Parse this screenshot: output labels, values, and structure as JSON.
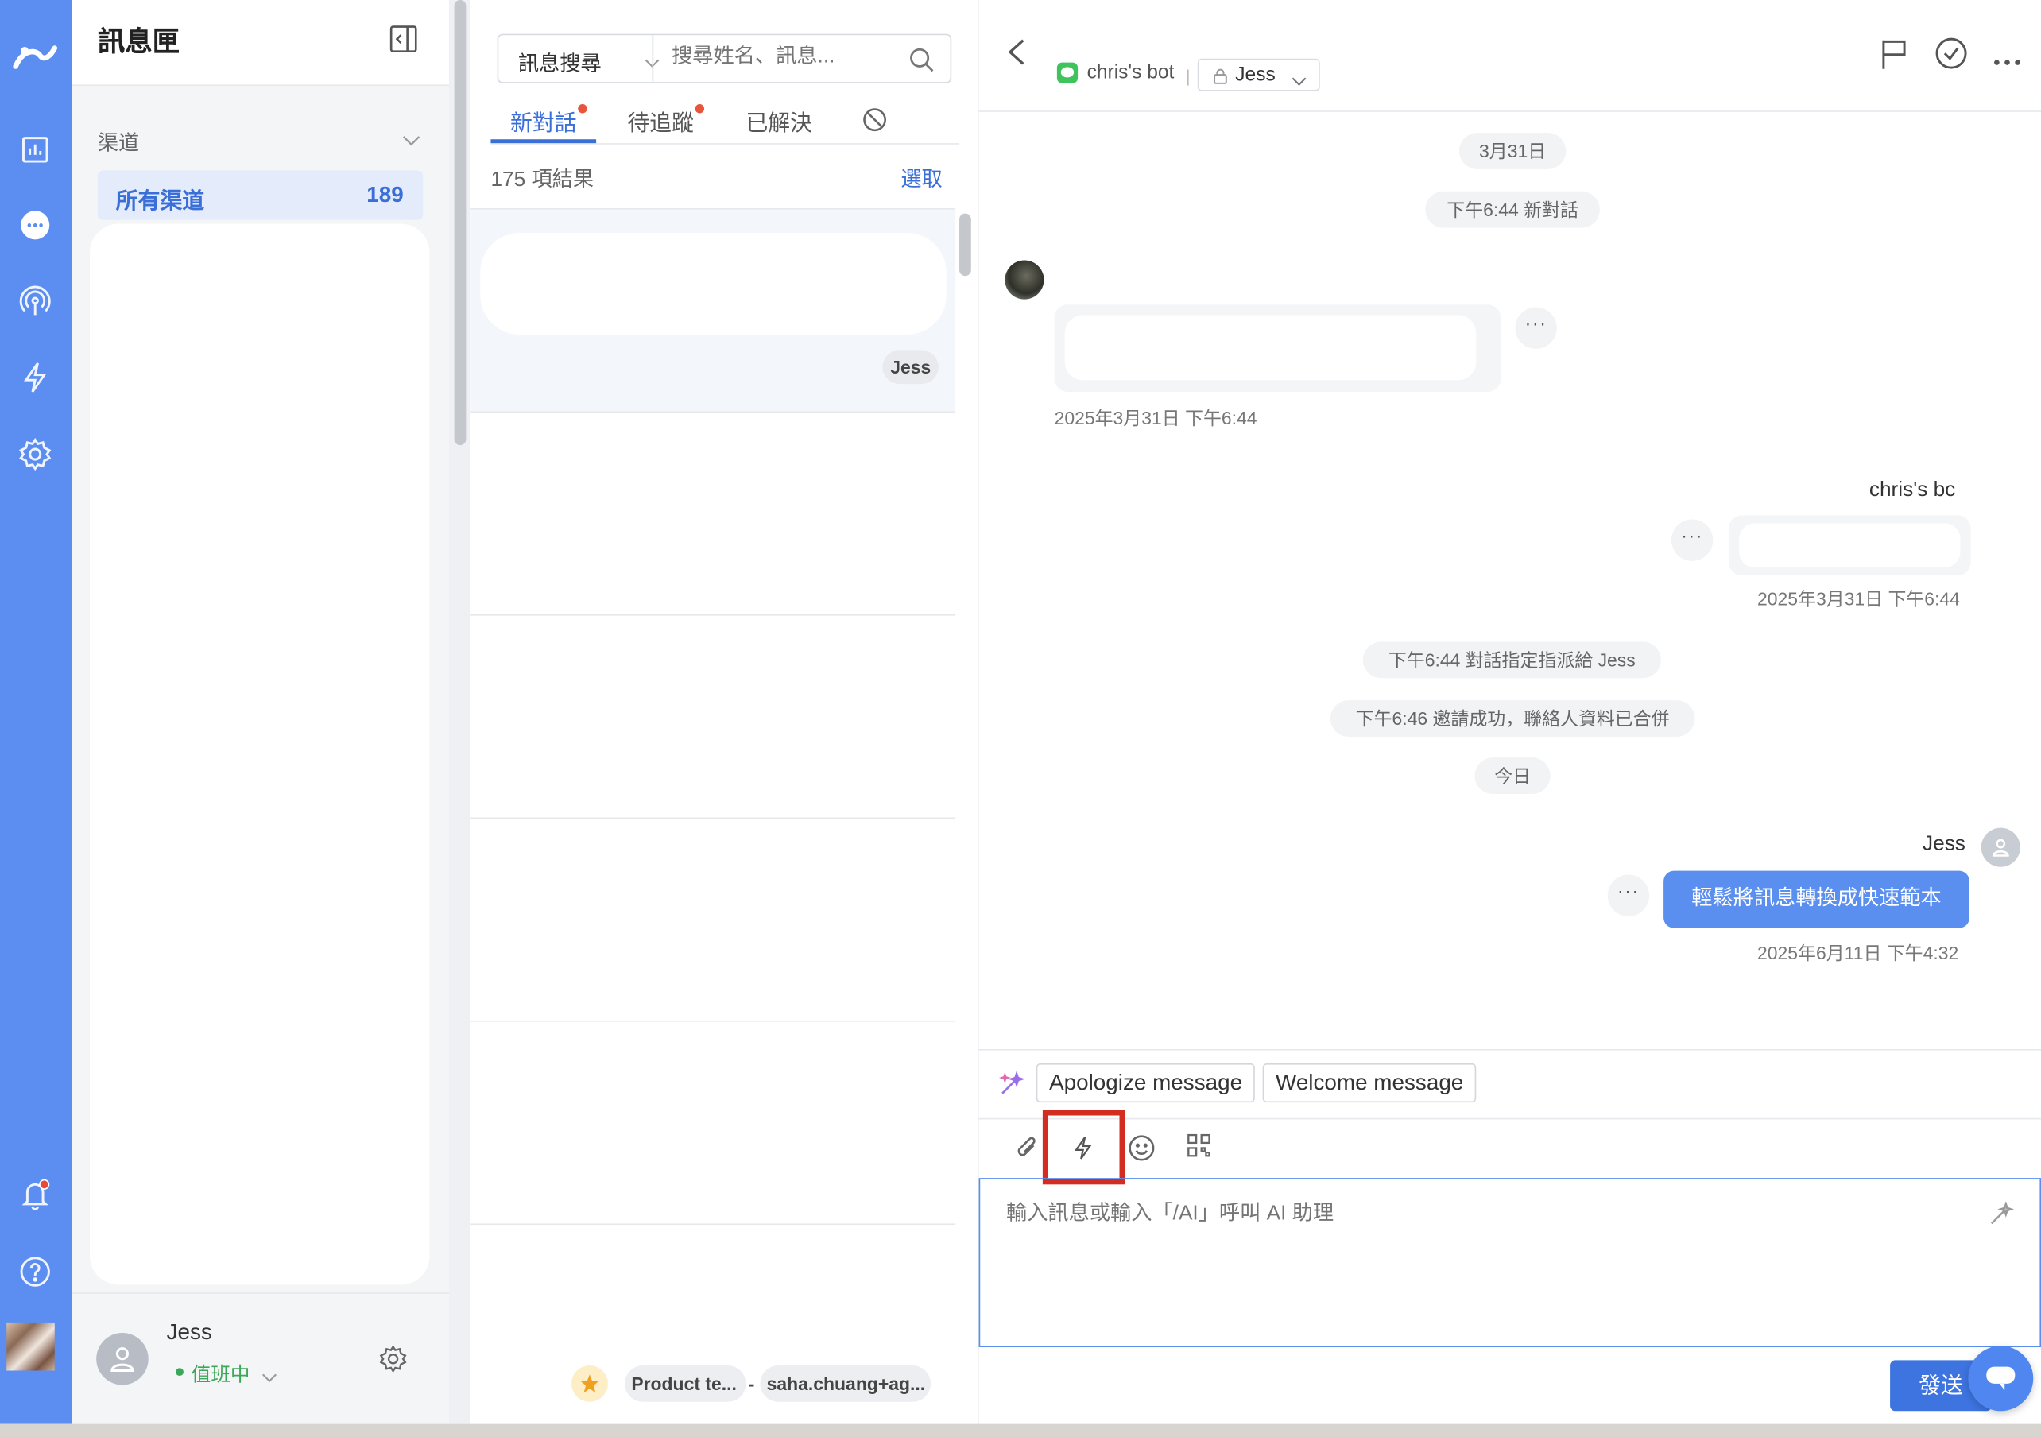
{
  "inbox": {
    "title": "訊息匣",
    "section_label": "渠道",
    "channel": {
      "label": "所有渠道",
      "count": "189"
    },
    "user": {
      "name": "Jess",
      "status": "值班中"
    }
  },
  "convlist": {
    "search_type": "訊息搜尋",
    "search_placeholder": "搜尋姓名、訊息...",
    "tabs": [
      {
        "label": "新對話",
        "has_dot": true,
        "active": true
      },
      {
        "label": "待追蹤",
        "has_dot": true,
        "active": false
      },
      {
        "label": "已解決",
        "has_dot": false,
        "active": false
      }
    ],
    "results": "175 項結果",
    "select_label": "選取",
    "first_item_tag": "Jess",
    "last_item_chips": [
      "Product te...",
      "-",
      "saha.chuang+ag..."
    ]
  },
  "chat": {
    "bot_name": "chris's bot",
    "assignee": "Jess",
    "system_date_1": "3月31日",
    "system_new": "下午6:44 新對話",
    "incoming_time": "2025年3月31日 下午6:44",
    "bot_sender": "chris's bc",
    "bot_time": "2025年3月31日 下午6:44",
    "system_assigned": "下午6:44 對話指定指派給  Jess",
    "system_merged": "下午6:46 邀請成功，聯絡人資料已合併",
    "system_today": "今日",
    "agent_name": "Jess",
    "agent_message": "輕鬆將訊息轉換成快速範本",
    "agent_time": "2025年6月11日 下午4:32",
    "more_label": "···",
    "suggestions": [
      "Apologize message",
      "Welcome message"
    ],
    "composer_placeholder": "輸入訊息或輸入「/AI」呼叫 AI 助理",
    "send_label": "發送"
  },
  "colors": {
    "brand": "#5b8ef0",
    "accent": "#3a6fd8",
    "highlight": "#d22d20",
    "online": "#3aa856"
  }
}
